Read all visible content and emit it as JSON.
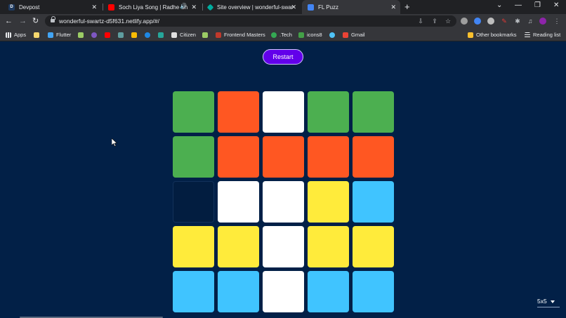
{
  "browser": {
    "tabs": [
      {
        "title": "Devpost",
        "favicon": "D",
        "favicon_color": "#1f3a5f",
        "active": false
      },
      {
        "title": "Soch Liya Song | Radhe Shyam",
        "favicon": "",
        "favicon_color": "#ff0000",
        "active": false,
        "audio": "🔊"
      },
      {
        "title": "Site overview | wonderful-swartz",
        "favicon": "",
        "favicon_color": "#00ad9f",
        "active": false
      },
      {
        "title": "FL Puzz",
        "favicon": "",
        "favicon_color": "#4285f4",
        "active": true
      }
    ],
    "url": "wonderful-swartz-d5f631.netlify.app/#/",
    "bookmarks": [
      {
        "label": "Apps",
        "color": "#e8eaed"
      },
      {
        "label": "",
        "color": "#f5d76e"
      },
      {
        "label": "Flutter",
        "color": "#42a5f5"
      },
      {
        "label": "",
        "color": "#9ccc65"
      },
      {
        "label": "",
        "color": "#7e57c2"
      },
      {
        "label": "",
        "color": "#ff0000"
      },
      {
        "label": "",
        "color": "#5f9ea0"
      },
      {
        "label": "",
        "color": "#fbbc04"
      },
      {
        "label": "",
        "color": "#1e88e5"
      },
      {
        "label": "",
        "color": "#26a69a"
      },
      {
        "label": "Citizen",
        "color": "#e0e0e0"
      },
      {
        "label": "Frontend Masters",
        "color": "#c0392b"
      },
      {
        "label": ".Tech",
        "color": "#34a853"
      },
      {
        "label": "icons8",
        "color": "#43a047"
      },
      {
        "label": "",
        "color": "#4fc3f7"
      },
      {
        "label": "Gmail",
        "color": "#ea4335"
      },
      {
        "label": "Other bookmarks",
        "color": "#fbc02d"
      },
      {
        "label": "Reading list",
        "color": "#e8eaed"
      }
    ],
    "window_controls": {
      "minimize": "—",
      "restore": "❐",
      "close": "✕"
    },
    "tab_list": "⌄"
  },
  "app": {
    "restart_label": "Restart",
    "size_selected": "5x5",
    "grid_size": 5,
    "colors": {
      "green": "#4caf50",
      "orange": "#ff5722",
      "white": "#ffffff",
      "yellow": "#ffeb3b",
      "blue": "#40c4ff",
      "empty": "empty"
    },
    "tiles": [
      [
        "green",
        "orange",
        "white",
        "green",
        "green"
      ],
      [
        "green",
        "orange",
        "orange",
        "orange",
        "orange"
      ],
      [
        "empty",
        "white",
        "white",
        "yellow",
        "blue"
      ],
      [
        "yellow",
        "yellow",
        "white",
        "yellow",
        "yellow"
      ],
      [
        "blue",
        "blue",
        "white",
        "blue",
        "blue"
      ]
    ]
  }
}
